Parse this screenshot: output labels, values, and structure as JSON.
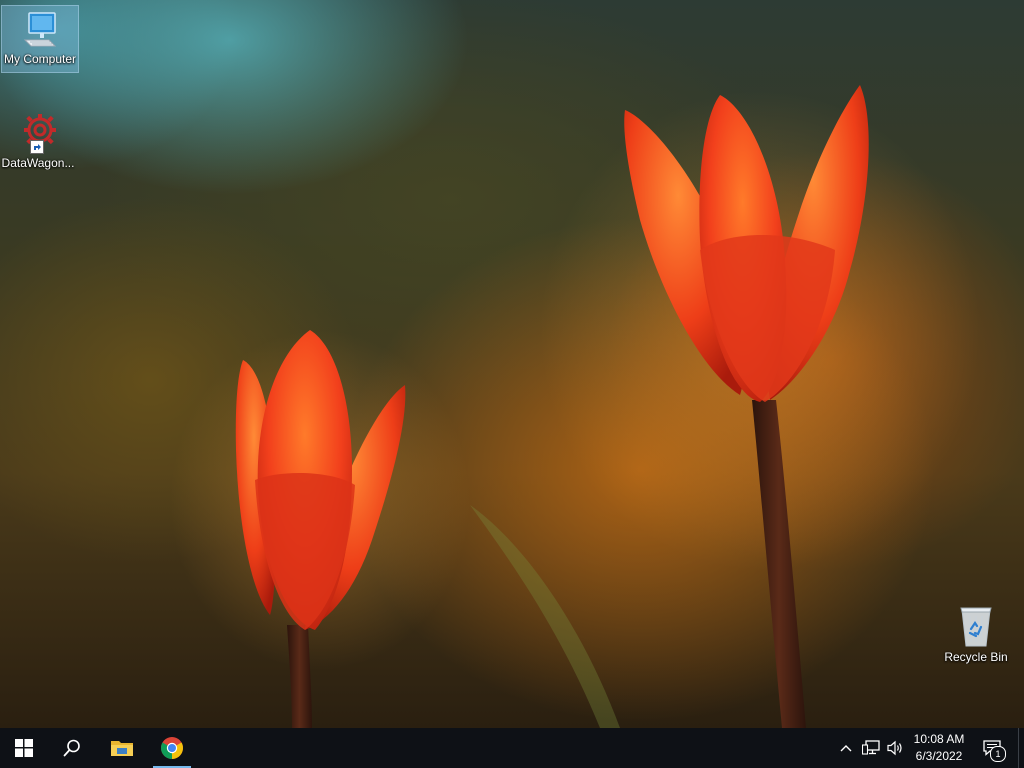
{
  "desktop": {
    "icons": [
      {
        "label": "My Computer",
        "icon": "computer-icon"
      },
      {
        "label": "DataWagon...",
        "icon": "datawagon-gear-icon"
      },
      {
        "label": "Recycle Bin",
        "icon": "recycle-bin-icon"
      }
    ]
  },
  "taskbar": {
    "start": "windows-start-icon",
    "search": "search-icon",
    "pinned": [
      {
        "name": "File Explorer",
        "icon": "folder-icon"
      },
      {
        "name": "Google Chrome",
        "icon": "chrome-icon"
      }
    ],
    "tray": {
      "icons": [
        "chevron-up-icon",
        "network-icon",
        "speaker-icon"
      ],
      "time": "10:08 AM",
      "date": "6/3/2022",
      "notification_count": "1"
    }
  },
  "colors": {
    "taskbar_bg": "#0e1116",
    "active_indicator": "#76b9ed",
    "selection": "#8cc8f0"
  }
}
